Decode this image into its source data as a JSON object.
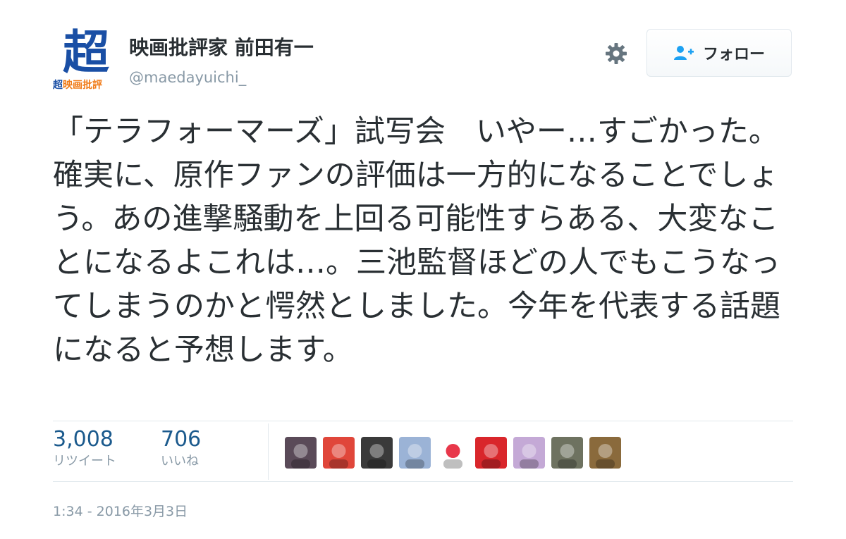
{
  "user": {
    "avatar_big": "超",
    "avatar_small_1": "超",
    "avatar_small_2": "映画批評",
    "display_name": "映画批評家 前田有一",
    "handle": "@maedayuichi_"
  },
  "actions": {
    "gear_icon": "gear-icon",
    "follow_icon": "follow-user-icon",
    "follow_label": "フォロー"
  },
  "tweet": {
    "text": "「テラフォーマーズ」試写会　いやー…すごかった。確実に、原作ファンの評価は一方的になることでしょう。あの進撃騒動を上回る可能性すらある、大変なことになるよこれは…。三池監督ほどの人でもこうなってしまうのかと愕然としました。今年を代表する話題になると予想します。"
  },
  "stats": {
    "retweets_count": "3,008",
    "retweets_label": "リツイート",
    "likes_count": "706",
    "likes_label": "いいね"
  },
  "likers": [
    {
      "icon": "anime-girl-avatar",
      "color": "#5a4a58"
    },
    {
      "icon": "red-hair-girl-avatar",
      "color": "#e0463a"
    },
    {
      "icon": "man-portrait-avatar",
      "color": "#3a3a3a"
    },
    {
      "icon": "blue-pattern-avatar",
      "color": "#9bb3d6"
    },
    {
      "icon": "cat-heart-avatar",
      "color": "#ffffff"
    },
    {
      "icon": "red-symbol-avatar",
      "color": "#d9262b"
    },
    {
      "icon": "pink-character-avatar",
      "color": "#c4a9d6"
    },
    {
      "icon": "dark-photo-avatar",
      "color": "#6e7260"
    },
    {
      "icon": "wood-photo-avatar",
      "color": "#8a6a3c"
    }
  ],
  "meta": {
    "timestamp": "1:34 - 2016年3月3日"
  }
}
